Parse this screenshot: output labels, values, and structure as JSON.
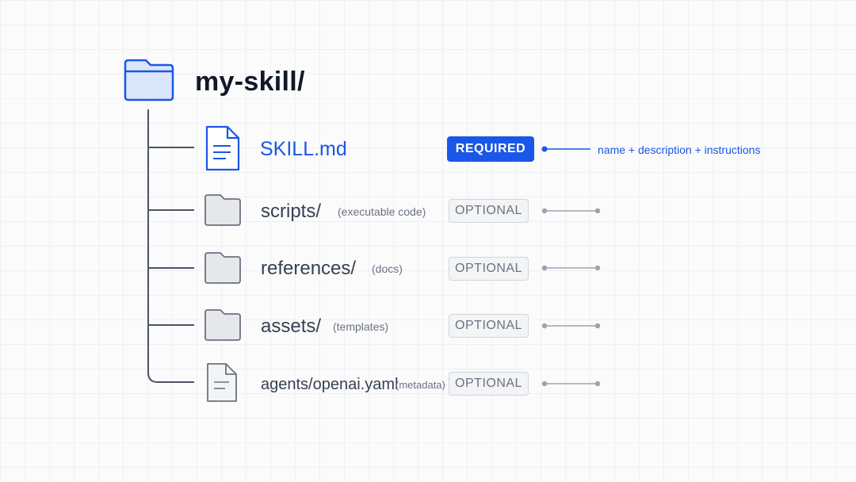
{
  "root": {
    "label": "my-skill/",
    "icon": "folder-icon",
    "color": "#1a56e8"
  },
  "entries": [
    {
      "name": "SKILL.md",
      "icon": "document-icon",
      "badge": "REQUIRED",
      "description": "name + description + instructions",
      "status": "required"
    },
    {
      "name": "scripts/",
      "icon": "folder-icon",
      "note": "(executable code)",
      "badge": "OPTIONAL",
      "status": "optional"
    },
    {
      "name": "references/",
      "icon": "folder-icon",
      "note": "(docs)",
      "badge": "OPTIONAL",
      "status": "optional"
    },
    {
      "name": "assets/",
      "icon": "folder-icon",
      "note": "(templates)",
      "badge": "OPTIONAL",
      "status": "optional"
    },
    {
      "name": "agents/openai.yaml",
      "icon": "document-icon",
      "note": "(metadata)",
      "badge": "OPTIONAL",
      "status": "optional"
    }
  ],
  "colors": {
    "accent": "#1a56e8",
    "muted": "#6b7280",
    "tree_line": "#4b5563"
  }
}
